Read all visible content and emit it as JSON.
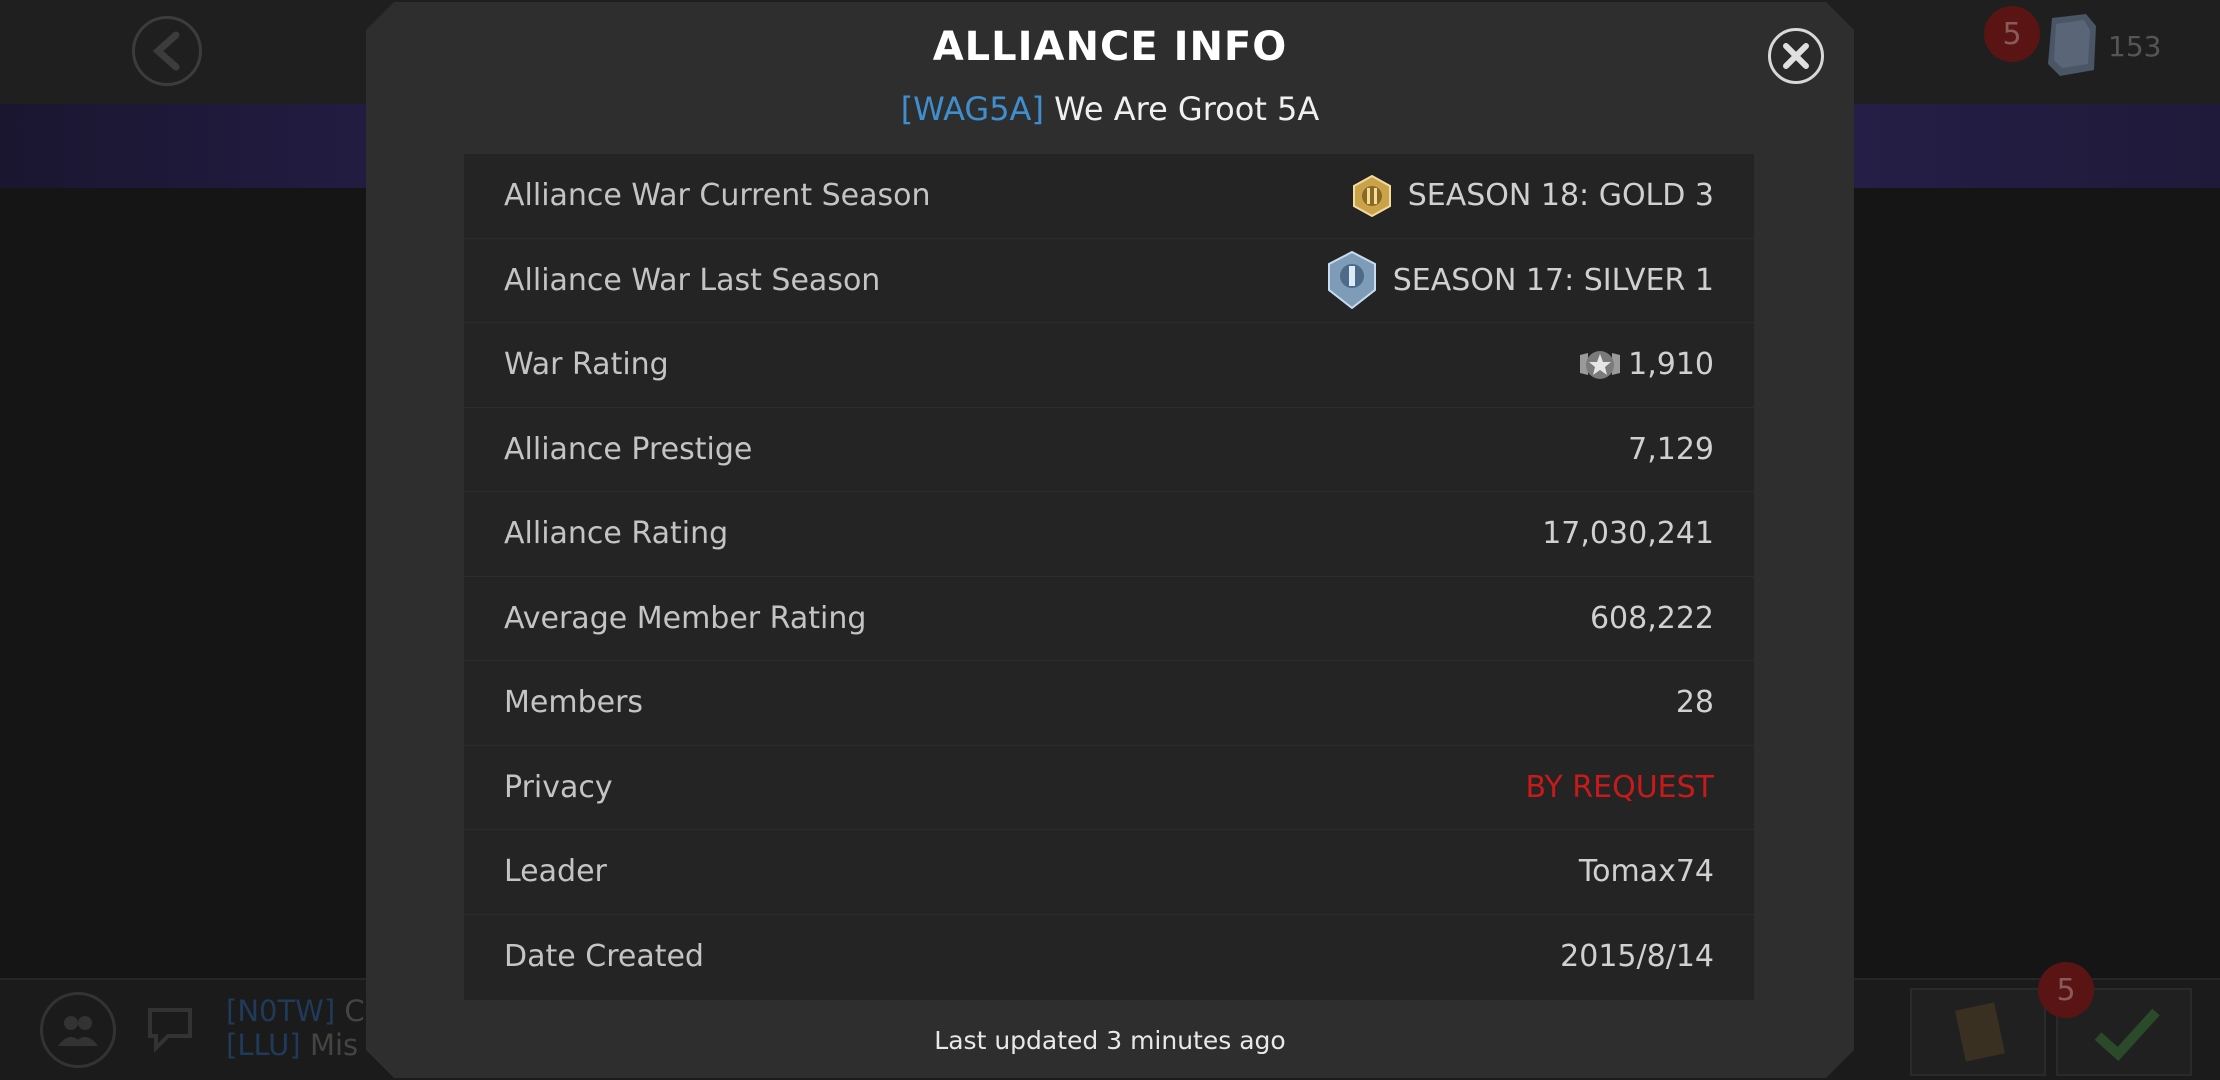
{
  "background": {
    "units_badge": "5",
    "units_count": "153",
    "quests_badge": "5",
    "chat": [
      {
        "tag": "[N0TW]",
        "text": "C"
      },
      {
        "tag": "[LLU]",
        "text": "Mis"
      }
    ]
  },
  "modal": {
    "title": "ALLIANCE INFO",
    "alliance_tag": "[WAG5A]",
    "alliance_name": "We Are Groot 5A",
    "rows": [
      {
        "label": "Alliance War Current Season",
        "value": "SEASON 18: GOLD 3",
        "icon": "gold-tier-icon"
      },
      {
        "label": "Alliance War Last Season",
        "value": "SEASON 17: SILVER 1",
        "icon": "silver-tier-icon"
      },
      {
        "label": "War Rating",
        "value": "1,910",
        "icon": "war-rating-star-icon"
      },
      {
        "label": "Alliance Prestige",
        "value": "7,129"
      },
      {
        "label": "Alliance Rating",
        "value": "17,030,241"
      },
      {
        "label": "Average Member Rating",
        "value": "608,222"
      },
      {
        "label": "Members",
        "value": "28"
      },
      {
        "label": "Privacy",
        "value": "BY REQUEST"
      },
      {
        "label": "Leader",
        "value": "Tomax74"
      },
      {
        "label": "Date Created",
        "value": "2015/8/14"
      }
    ],
    "footer": "Last updated 3 minutes ago"
  },
  "colors": {
    "tag_blue": "#3f8fd0",
    "privacy_red": "#c81a1a",
    "modal_bg": "#2e2e2e",
    "table_bg": "#242424"
  }
}
